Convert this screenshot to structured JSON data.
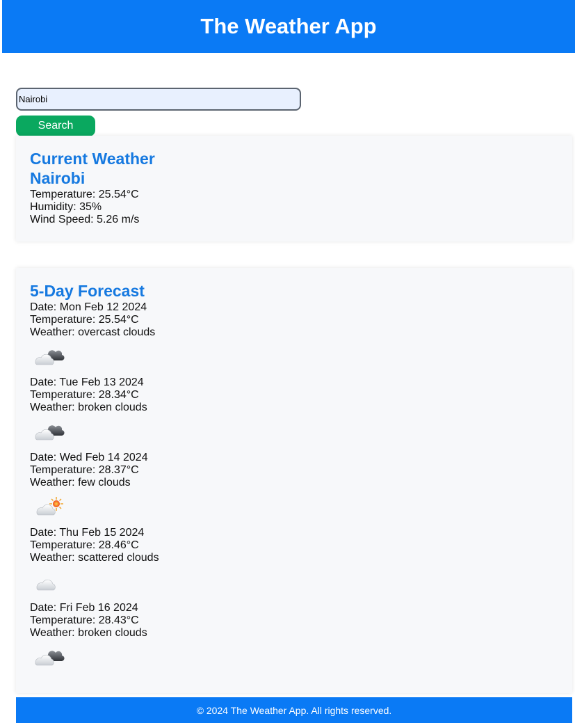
{
  "header": {
    "title": "The Weather App"
  },
  "search": {
    "value": "Nairobi",
    "button_label": "Search"
  },
  "current": {
    "heading": "Current Weather",
    "city": "Nairobi",
    "temperature": "Temperature: 25.54°C",
    "humidity": "Humidity: 35%",
    "wind": "Wind Speed: 5.26 m/s"
  },
  "forecast": {
    "heading": "5-Day Forecast",
    "days": [
      {
        "date": "Date: Mon Feb 12 2024",
        "temperature": "Temperature: 25.54°C",
        "weather": "Weather: overcast clouds",
        "icon": "overcast-clouds-icon"
      },
      {
        "date": "Date: Tue Feb 13 2024",
        "temperature": "Temperature: 28.34°C",
        "weather": "Weather: broken clouds",
        "icon": "broken-clouds-icon"
      },
      {
        "date": "Date: Wed Feb 14 2024",
        "temperature": "Temperature: 28.37°C",
        "weather": "Weather: few clouds",
        "icon": "few-clouds-icon"
      },
      {
        "date": "Date: Thu Feb 15 2024",
        "temperature": "Temperature: 28.46°C",
        "weather": "Weather: scattered clouds",
        "icon": "scattered-clouds-icon"
      },
      {
        "date": "Date: Fri Feb 16 2024",
        "temperature": "Temperature: 28.43°C",
        "weather": "Weather: broken clouds",
        "icon": "broken-clouds-icon"
      }
    ]
  },
  "footer": {
    "text": "© 2024 The Weather App. All rights reserved."
  },
  "colors": {
    "brand": "#0a7af5",
    "search_button": "#0aa85f",
    "heading": "#1679e0",
    "card_bg": "#f7f8fa"
  }
}
